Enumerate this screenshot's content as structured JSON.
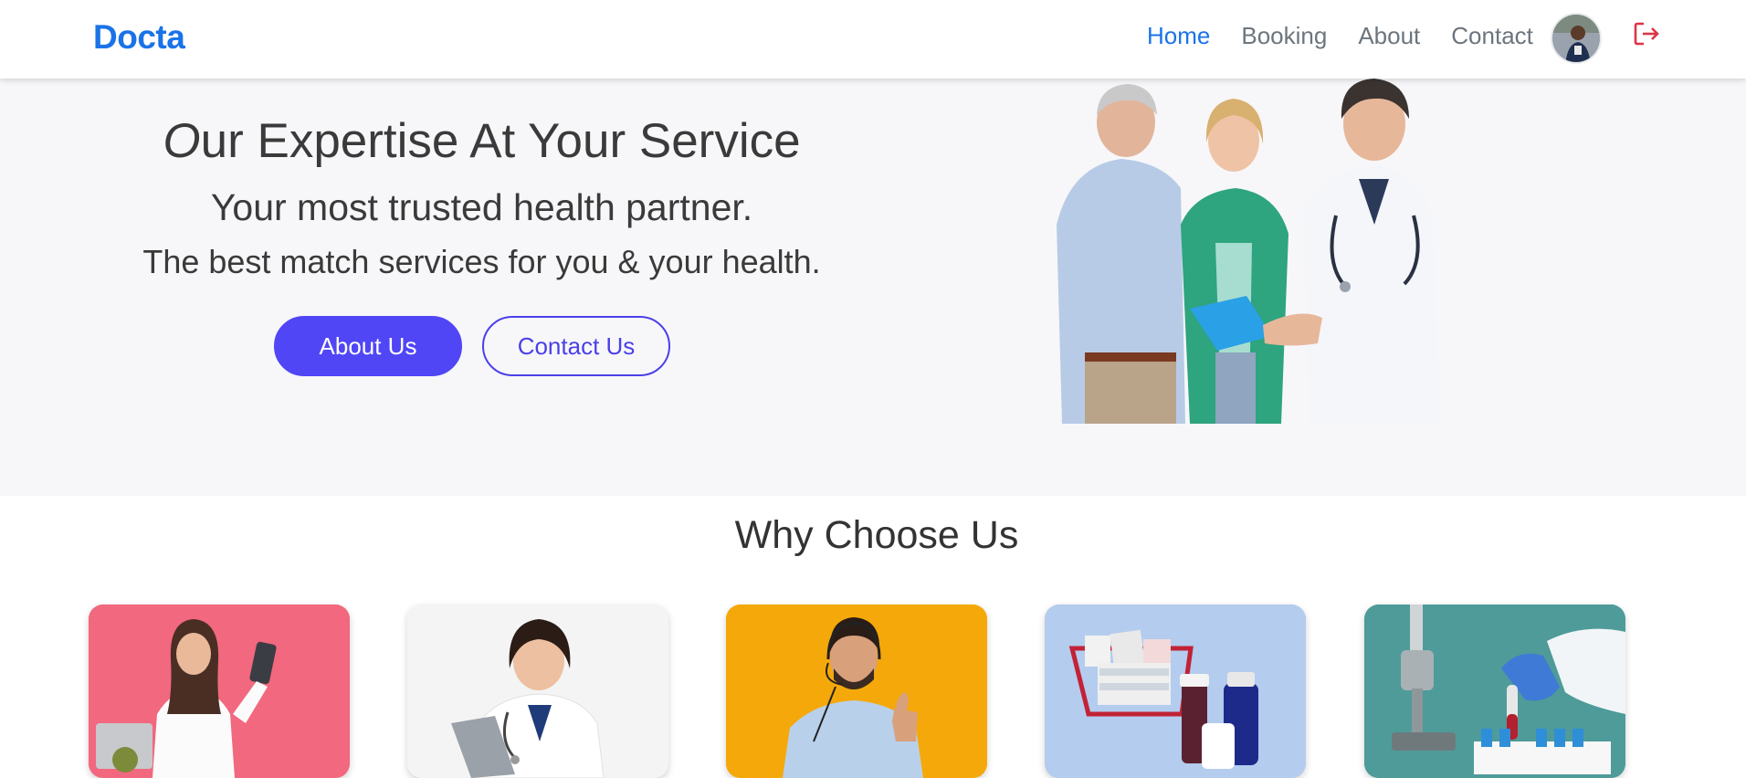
{
  "nav": {
    "brand": "Docta",
    "links": [
      "Home",
      "Booking",
      "About",
      "Contact"
    ],
    "active_link": "Home",
    "avatar_icon": "user-avatar",
    "logout_icon": "logout-icon",
    "accent_color": "#1a73e8",
    "logout_color": "#dc3545"
  },
  "hero": {
    "title": "Our Expertise At Your Service",
    "title_first_letter": "O",
    "title_rest": "ur Expertise At Your Service",
    "subtitle": "Your most trusted health partner.",
    "tagline": "The best match services for you & your health.",
    "primary_button": "About Us",
    "secondary_button": "Contact Us",
    "button_color": "#5046f5",
    "image": "doctor-consulting-couple-photo"
  },
  "why": {
    "title": "Why Choose Us",
    "cards": [
      {
        "image": "doctor-with-phone-photo",
        "bg": "#f2687e"
      },
      {
        "image": "female-doctor-clipboard-photo",
        "bg": "#f4f4f4"
      },
      {
        "image": "support-agent-headset-photo",
        "bg": "#f5a80a"
      },
      {
        "image": "medicine-cart-photo",
        "bg": "#b4ccee"
      },
      {
        "image": "lab-microscope-samples-photo",
        "bg": "#4e9b9a"
      }
    ]
  }
}
